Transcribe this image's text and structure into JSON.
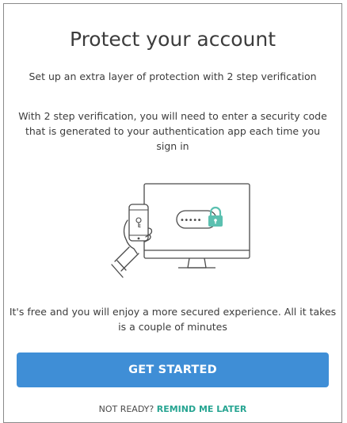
{
  "dialog": {
    "title": "Protect your account",
    "subtitle": "Set up an extra layer of protection with 2 step verification",
    "description": "With 2 step verification, you will need to enter a security code that is generated to your authentication app each time you sign in",
    "footer_text": "It's free and you will enjoy a more secured experience. All it takes is a couple of minutes",
    "primary_button_label": "GET STARTED",
    "not_ready_label": "NOT READY?",
    "remind_later_label": "REMIND ME LATER"
  },
  "illustration": {
    "icon": "2fa-phone-monitor-illustration",
    "password_mask": "•••••"
  },
  "colors": {
    "accent": "#3f8ed6",
    "link": "#27a592",
    "lock": "#5bc0b0",
    "line": "#4a4a4a"
  }
}
